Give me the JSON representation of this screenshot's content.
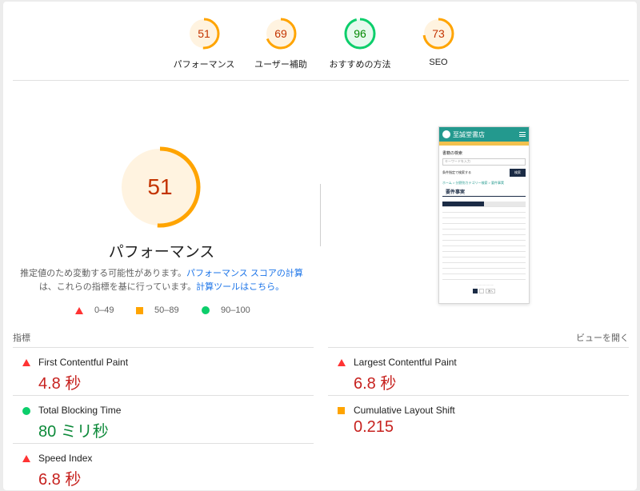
{
  "categories": [
    {
      "score": "51",
      "label": "パフォーマンス",
      "fraction": 0.51,
      "color": "#ffa400",
      "text_color": "#c33300",
      "bg": "#fff3e0"
    },
    {
      "score": "69",
      "label": "ユーザー補助",
      "fraction": 0.69,
      "color": "#ffa400",
      "text_color": "#c33300",
      "bg": "#fff3e0"
    },
    {
      "score": "96",
      "label": "おすすめの方法",
      "fraction": 0.96,
      "color": "#0cce6b",
      "text_color": "#008800",
      "bg": "#e6f9ee"
    },
    {
      "score": "73",
      "label": "SEO",
      "fraction": 0.73,
      "color": "#ffa400",
      "text_color": "#c33300",
      "bg": "#fff3e0"
    }
  ],
  "main": {
    "score": "51",
    "fraction": 0.51,
    "title": "パフォーマンス",
    "desc_part1": "推定値のため変動する可能性があります。",
    "desc_link1": "パフォーマンス スコアの計算",
    "desc_part2": "は、これらの指標を基に行っています。",
    "desc_link2": "計算ツールはこちら。"
  },
  "legend": {
    "fail": "0–49",
    "average": "50–89",
    "pass": "90–100"
  },
  "screenshot": {
    "site_name": "至誠堂書店",
    "search_heading": "書籍の検索",
    "search_placeholder": "キーワードを入力",
    "advanced_label": "条件指定で検索する",
    "search_button": "検索",
    "breadcrumb": "ホーム > 分野別カテゴリー検索 > 要件事実",
    "section_title": "要件事実",
    "pager_next": "次へ"
  },
  "metrics_header": {
    "left": "指標",
    "right": "ビューを開く"
  },
  "metrics": {
    "fcp": {
      "name": "First Contentful Paint",
      "value": "4.8 秒"
    },
    "lcp": {
      "name": "Largest Contentful Paint",
      "value": "6.8 秒"
    },
    "tbt": {
      "name": "Total Blocking Time",
      "value": "80 ミリ秒"
    },
    "cls": {
      "name": "Cumulative Layout Shift",
      "value": "0.215"
    },
    "si": {
      "name": "Speed Index",
      "value": "6.8 秒"
    }
  }
}
